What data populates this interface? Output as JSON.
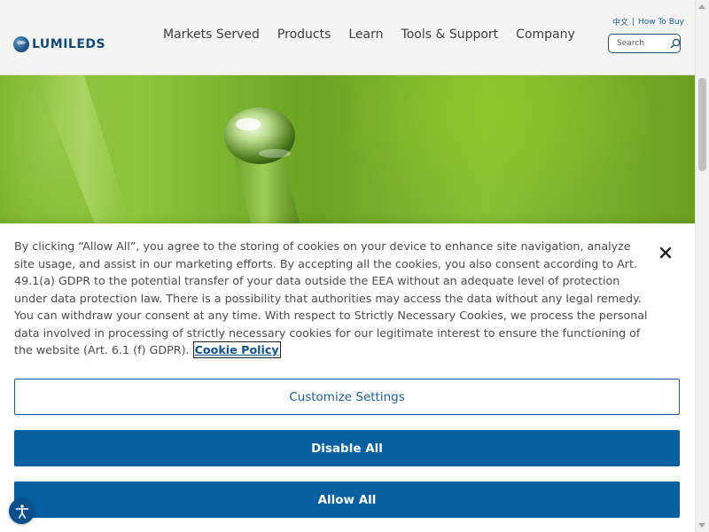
{
  "header": {
    "logo_text": "LUMILEDS",
    "nav": [
      {
        "label": "Markets Served"
      },
      {
        "label": "Products"
      },
      {
        "label": "Learn"
      },
      {
        "label": "Tools & Support"
      },
      {
        "label": "Company"
      }
    ],
    "top_links": {
      "language": "中文",
      "separator": "|",
      "how_to_buy": "How To Buy"
    },
    "search": {
      "placeholder": "Search",
      "icon": "search-icon"
    }
  },
  "hero": {
    "image": "water-droplet-on-grass-blade"
  },
  "cookie_banner": {
    "text": "By clicking “Allow All”, you agree to the storing of cookies on your device to enhance site navigation, analyze site usage, and assist in our marketing efforts. By accepting all the cookies, you also consent according to Art. 49.1(a) GDPR to the potential transfer of your data outside the EEA without an adequate level of protection under data protection law. There is a possibility that authorities may access the data without any legal remedy. You can withdraw your consent at any time. With respect to Strictly Necessary Cookies, we process the personal data involved in processing of strictly necessary cookies for our legitimate interest to ensure the functioning of the website (Art. 6.1 (f) GDPR).",
    "policy_link": "Cookie Policy",
    "close_icon": "close-icon",
    "customize_label": "Customize Settings",
    "disable_label": "Disable All",
    "allow_label": "Allow All"
  },
  "accessibility": {
    "icon": "accessibility-icon"
  },
  "colors": {
    "brand_blue": "#065f9f",
    "nav_text": "#3c3c3c",
    "link_blue": "#10508e"
  }
}
